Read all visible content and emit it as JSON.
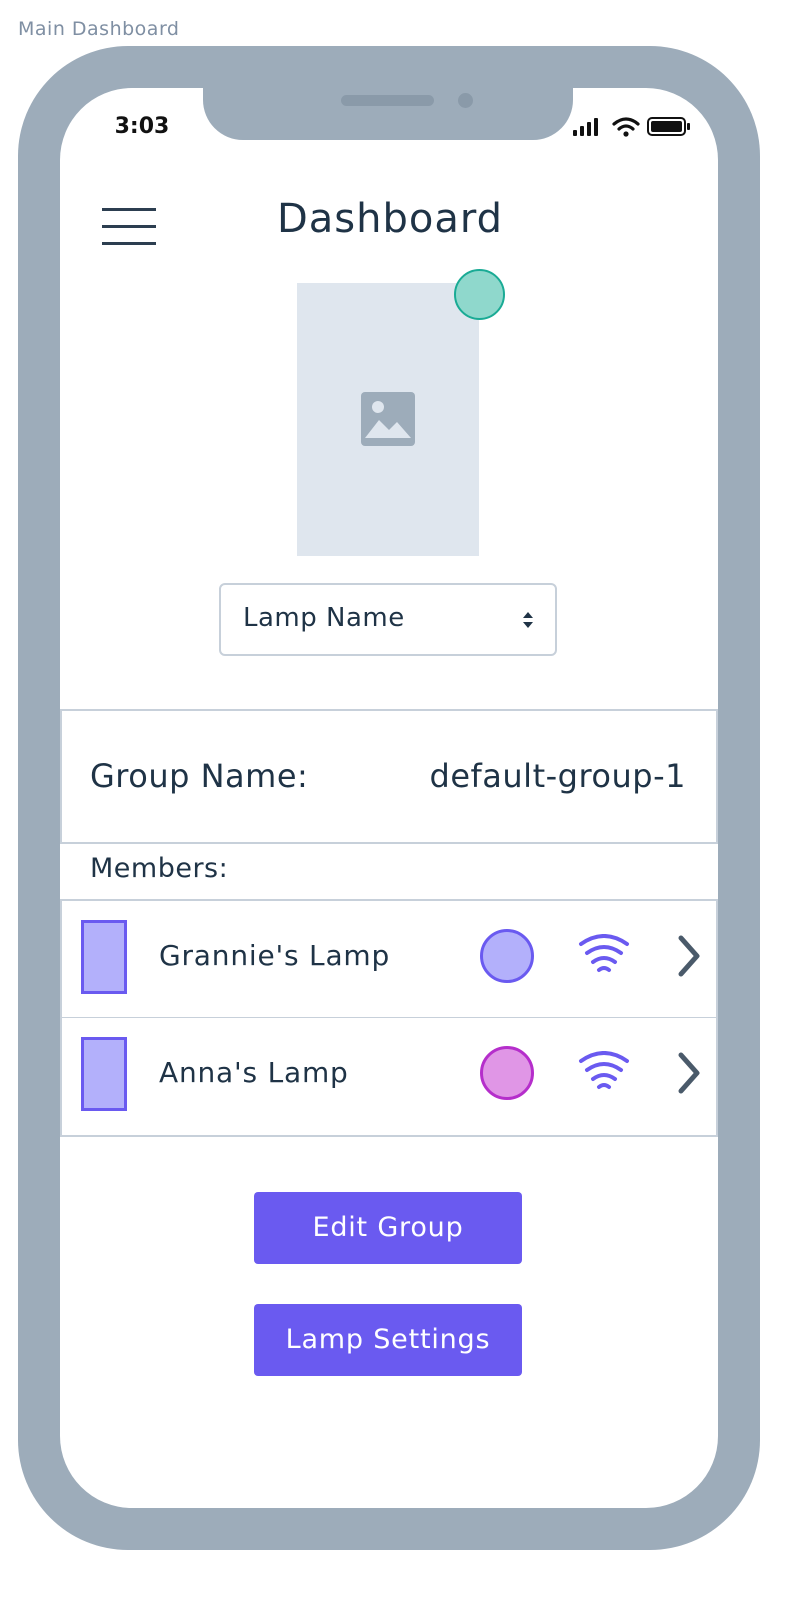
{
  "artboard": {
    "label": "Main Dashboard"
  },
  "status_bar": {
    "time": "3:03",
    "icons": [
      "signal-icon",
      "wifi-icon",
      "battery-icon"
    ]
  },
  "header": {
    "title": "Dashboard",
    "menu_icon": "menu-icon"
  },
  "lamp": {
    "image_icon": "image-placeholder-icon",
    "status_color": "#8fd8cc",
    "selector": {
      "value": "Lamp Name"
    }
  },
  "group": {
    "label": "Group Name:",
    "value": "default-group-1"
  },
  "members": {
    "label": "Members:",
    "items": [
      {
        "name": "Grannie's Lamp",
        "color": "#b3b0fb",
        "color_border": "#6a5af0"
      },
      {
        "name": "Anna's Lamp",
        "color": "#e096e6",
        "color_border": "#b52ecb"
      }
    ]
  },
  "actions": {
    "edit_group": "Edit Group",
    "lamp_settings": "Lamp Settings"
  },
  "colors": {
    "accent": "#6a5af0",
    "frame": "#9dacba",
    "text": "#1f3346",
    "border": "#c7d0da"
  }
}
